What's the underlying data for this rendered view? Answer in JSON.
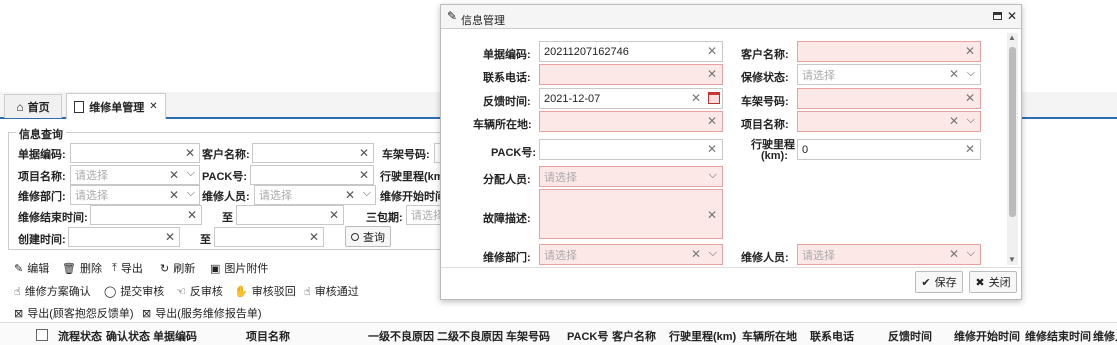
{
  "tabs": [
    {
      "label": "首页"
    },
    {
      "label": "维修单管理"
    }
  ],
  "query": {
    "legend": "信息查询",
    "fields": {
      "order_no": "单据编码:",
      "customer": "客户名称:",
      "frame_no": "车架号码:",
      "project": "项目名称:",
      "pack": "PACK号:",
      "mileage": "行驶里程(km)",
      "dept": "维修部门:",
      "person": "维修人员:",
      "start_time": "维修开始时间",
      "end_time": "维修结束时间:",
      "to": "至",
      "warranty": "三包期:",
      "created": "创建时间:"
    },
    "placeholder": "请选择",
    "search_button": "查询"
  },
  "toolbar1": [
    "编辑",
    "删除",
    "导出",
    "刷新",
    "图片附件"
  ],
  "toolbar2": [
    "维修方案确认",
    "提交审核",
    "反审核",
    "审核驳回",
    "审核通过"
  ],
  "toolbar3": [
    "导出(顾客抱怨反馈单)",
    "导出(服务维修报告单)"
  ],
  "table_headers": [
    "流程状态",
    "确认状态",
    "单据编码",
    "项目名称",
    "一级不良原因",
    "二级不良原因",
    "车架号码",
    "PACK号",
    "客户名称",
    "行驶里程(km)",
    "车辆所在地",
    "联系电话",
    "反馈时间",
    "维修开始时间",
    "维修结束时间",
    "维修人"
  ],
  "modal": {
    "title": "信息管理",
    "labels": {
      "order_no": "单据编码:",
      "customer": "客户名称:",
      "phone": "联系电话:",
      "warranty": "保修状态:",
      "feedback_time": "反馈时间:",
      "frame_no": "车架号码:",
      "location": "车辆所在地:",
      "project": "项目名称:",
      "pack": "PACK号:",
      "mileage_line1": "行驶里程",
      "mileage_line2": "(km):",
      "assignee": "分配人员:",
      "fault": "故障描述:",
      "dept": "维修部门:",
      "person": "维修人员:"
    },
    "values": {
      "order_no": "20211207162746",
      "feedback_time": "2021-12-07",
      "mileage": "0"
    },
    "placeholder": "请选择",
    "save": "保存",
    "close": "关闭"
  }
}
